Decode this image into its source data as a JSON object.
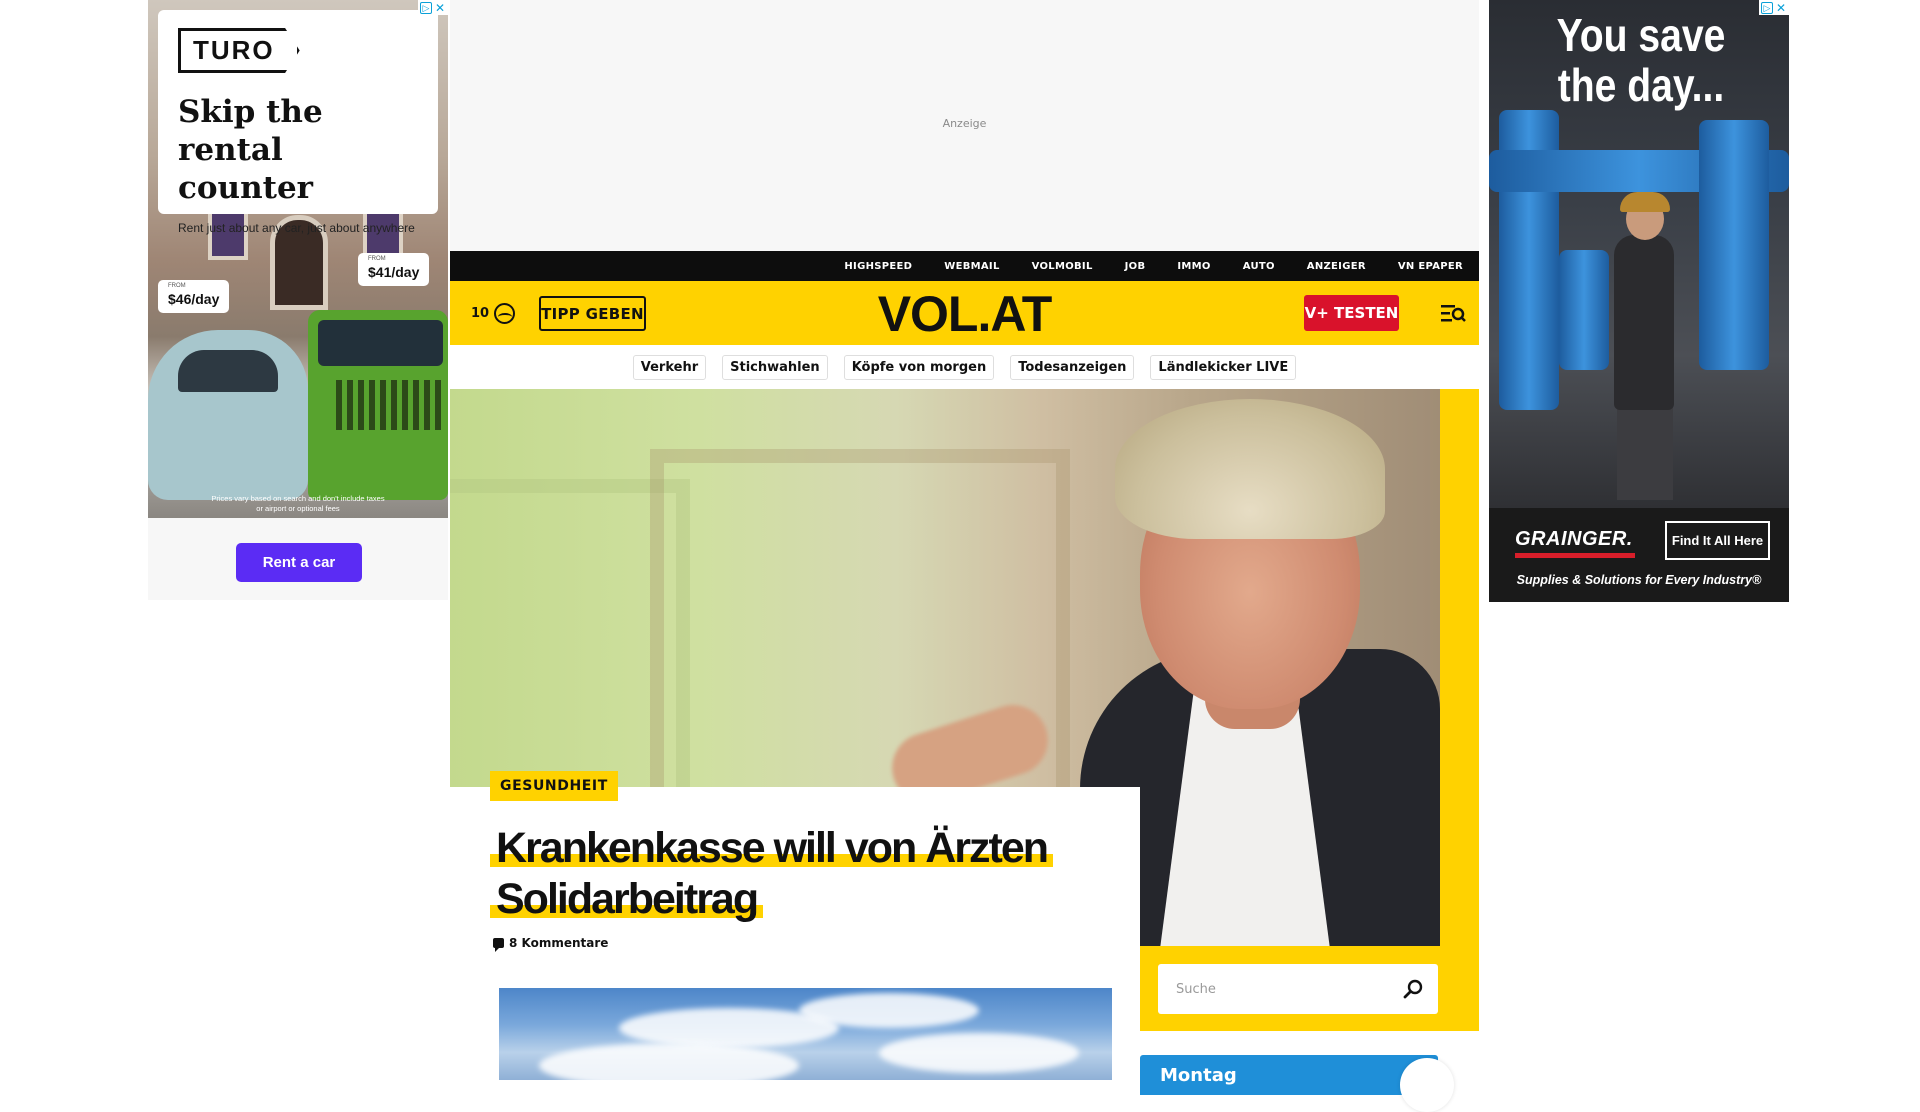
{
  "ads": {
    "left": {
      "brand": "TURO",
      "headline": "Skip the rental counter",
      "subline": "Rent just about any car, just about anywhere",
      "price_1_from": "FROM",
      "price_1": "$46/day",
      "price_2_from": "FROM",
      "price_2": "$41/day",
      "disclaimer": "Prices vary based on search and don't include taxes or airport or optional fees",
      "cta": "Rent a car"
    },
    "right": {
      "headline": "You save the day...",
      "brand": "GRAINGER.",
      "cta": "Find It All Here",
      "tagline": "Supplies & Solutions for Every Industry®"
    },
    "anzeige_label": "Anzeige"
  },
  "topbar": {
    "links": [
      "HIGHSPEED",
      "WEBMAIL",
      "VOLMOBIL",
      "JOB",
      "IMMO",
      "AUTO",
      "ANZEIGER",
      "VN EPAPER"
    ]
  },
  "header": {
    "temperature": "10",
    "tipp_label": "TIPP GEBEN",
    "logo": "VOL.AT",
    "vplus_label": "V+ TESTEN"
  },
  "quicknav": {
    "chips": [
      "Verkehr",
      "Stichwahlen",
      "Köpfe von morgen",
      "Todesanzeigen",
      "Ländlekicker LIVE"
    ]
  },
  "hero": {
    "category": "GESUNDHEIT",
    "headline_line1": "Krankenkasse will von Ärzten",
    "headline_line2": "Solidarbeitrag",
    "comments": "8 Kommentare"
  },
  "search": {
    "placeholder": "Suche"
  },
  "weather": {
    "day": "Montag"
  },
  "colors": {
    "brand_yellow": "#ffd200",
    "topbar_black": "#0d0d0d",
    "vplus_red": "#d9122b",
    "turo_purple": "#5b2cf4",
    "weather_blue": "#1f8fd8",
    "grainger_red": "#d81e2a"
  },
  "icons": {
    "weather": "sun-cloud-icon",
    "menu": "menu-search-icon",
    "search": "magnifier-icon",
    "comment": "comment-bubble-icon"
  }
}
